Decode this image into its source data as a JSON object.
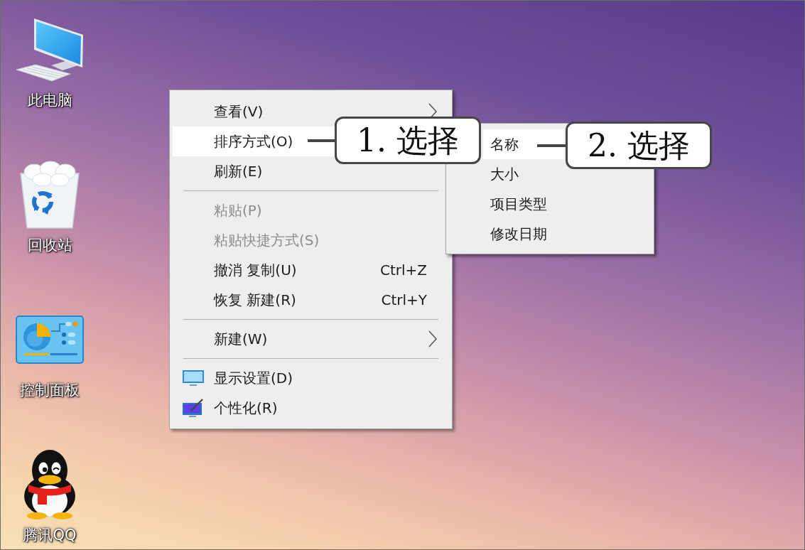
{
  "desktop_icons": [
    {
      "kind": "computer",
      "label": "此电脑"
    },
    {
      "kind": "recycle_bin",
      "label": "回收站"
    },
    {
      "kind": "control_panel",
      "label": "控制面板"
    },
    {
      "kind": "penguin",
      "label": "腾讯QQ"
    }
  ],
  "context_menu": {
    "groups": [
      {
        "items": [
          {
            "label": "查看(V)",
            "selected": false,
            "disabled": false,
            "has_submenu": true
          },
          {
            "label": "排序方式(O)",
            "selected": true,
            "disabled": false,
            "has_submenu": false
          },
          {
            "label": "刷新(E)",
            "selected": false,
            "disabled": false,
            "has_submenu": false
          }
        ]
      },
      {
        "items": [
          {
            "label": "粘贴(P)",
            "selected": false,
            "disabled": true,
            "has_submenu": false
          },
          {
            "label": "粘贴快捷方式(S)",
            "selected": false,
            "disabled": true,
            "has_submenu": false
          },
          {
            "label": "撤消 复制(U)",
            "shortcut": "Ctrl+Z",
            "selected": false,
            "disabled": false,
            "has_submenu": false
          },
          {
            "label": "恢复 新建(R)",
            "shortcut": "Ctrl+Y",
            "selected": false,
            "disabled": false,
            "has_submenu": false
          }
        ]
      },
      {
        "items": [
          {
            "label": "新建(W)",
            "selected": false,
            "disabled": false,
            "has_submenu": true
          }
        ]
      },
      {
        "items": [
          {
            "label": "显示设置(D)",
            "selected": false,
            "disabled": false,
            "has_submenu": false
          },
          {
            "label": "个性化(R)",
            "selected": false,
            "disabled": false,
            "has_submenu": false
          }
        ]
      }
    ]
  },
  "submenu": {
    "items": [
      {
        "label": "名称",
        "selected": true
      },
      {
        "label": "大小",
        "selected": false
      },
      {
        "label": "项目类型",
        "selected": false
      },
      {
        "label": "修改日期",
        "selected": false
      }
    ]
  },
  "callouts": [
    {
      "text": "1. 选择"
    },
    {
      "text": "2. 选择"
    }
  ]
}
